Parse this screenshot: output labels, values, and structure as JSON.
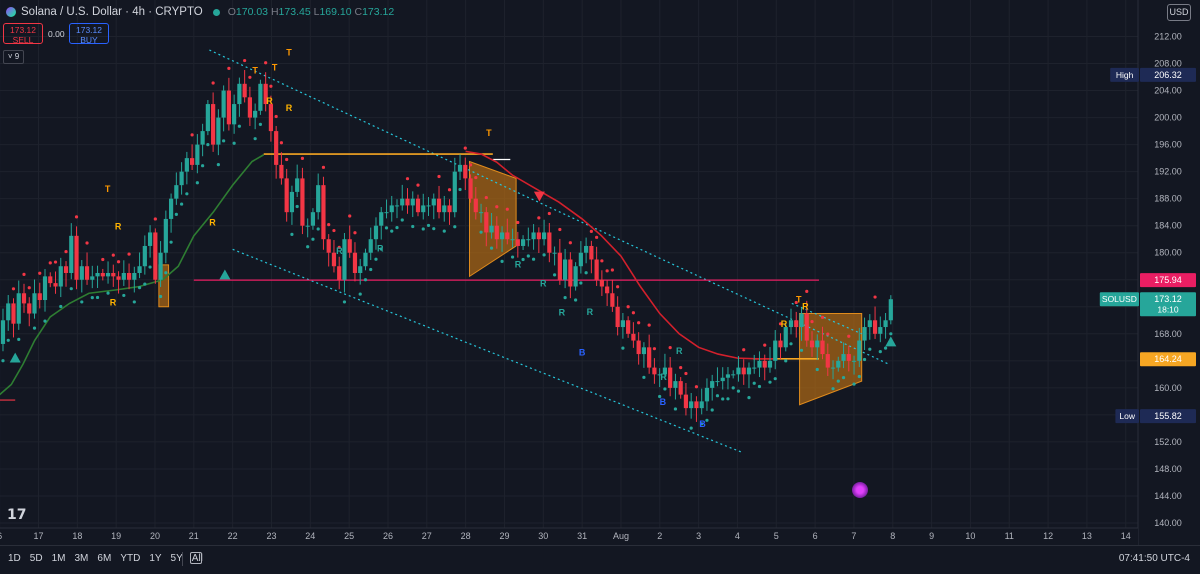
{
  "header": {
    "title": "Solana / U.S. Dollar · 4h · CRYPTO",
    "ohlc": {
      "o_label": "O",
      "o": "170.03",
      "h_label": "H",
      "h": "173.45",
      "l_label": "L",
      "l": "169.10",
      "c_label": "C",
      "c": "173.12"
    }
  },
  "trade": {
    "sell_price": "173.12",
    "sell_label": "SELL",
    "spread": "0.00",
    "buy_price": "173.12",
    "buy_label": "BUY"
  },
  "indicator_count": "9",
  "currency": "USD",
  "bottom": {
    "ranges": [
      "1D",
      "5D",
      "1M",
      "3M",
      "6M",
      "YTD",
      "1Y",
      "5Y",
      "All"
    ],
    "clock": "07:41:50 UTC-4"
  },
  "colors": {
    "bg": "#131722",
    "up": "#26a69a",
    "down": "#f23645",
    "ma_red": "#d3202c",
    "ma_green": "#2e7d32",
    "level_pink": "#e91e63",
    "level_orange": "#f6a623"
  },
  "chart_data": {
    "type": "candlestick",
    "yticks": [
      140,
      144,
      148,
      152,
      156,
      160,
      164,
      168,
      172,
      176,
      180,
      184,
      188,
      192,
      196,
      200,
      204,
      208,
      212
    ],
    "ylim": [
      140,
      214
    ],
    "xticks": [
      {
        "label": "6",
        "t": -1
      },
      {
        "label": "17",
        "t": 0
      },
      {
        "label": "18",
        "t": 1
      },
      {
        "label": "19",
        "t": 2
      },
      {
        "label": "20",
        "t": 3
      },
      {
        "label": "21",
        "t": 4
      },
      {
        "label": "22",
        "t": 5
      },
      {
        "label": "23",
        "t": 6
      },
      {
        "label": "24",
        "t": 7
      },
      {
        "label": "25",
        "t": 8
      },
      {
        "label": "26",
        "t": 9
      },
      {
        "label": "27",
        "t": 10
      },
      {
        "label": "28",
        "t": 11
      },
      {
        "label": "29",
        "t": 12
      },
      {
        "label": "30",
        "t": 13
      },
      {
        "label": "31",
        "t": 14
      },
      {
        "label": "Aug",
        "t": 15
      },
      {
        "label": "2",
        "t": 16
      },
      {
        "label": "3",
        "t": 17
      },
      {
        "label": "4",
        "t": 18
      },
      {
        "label": "5",
        "t": 19
      },
      {
        "label": "6",
        "t": 20
      },
      {
        "label": "7",
        "t": 21
      },
      {
        "label": "8",
        "t": 22
      },
      {
        "label": "9",
        "t": 23
      },
      {
        "label": "10",
        "t": 24
      },
      {
        "label": "11",
        "t": 25
      },
      {
        "label": "12",
        "t": 26
      },
      {
        "label": "13",
        "t": 27
      },
      {
        "label": "14",
        "t": 28
      }
    ],
    "price_labels": [
      {
        "label": "High",
        "value": "206.32",
        "y": 206.32,
        "color": "#1e2a55"
      },
      {
        "label": "",
        "value": "175.94",
        "y": 175.94,
        "color": "#e91e63"
      },
      {
        "label": "SOLUSD",
        "value": "173.12",
        "sub": "18:10",
        "y": 173.12,
        "color": "#26a69a"
      },
      {
        "label": "",
        "value": "164.24",
        "y": 164.24,
        "color": "#f6a623"
      },
      {
        "label": "Low",
        "value": "155.82",
        "y": 155.82,
        "color": "#1e2a55"
      }
    ],
    "closes": [
      166.5,
      170,
      172.5,
      169.5,
      174,
      172.5,
      171,
      174,
      173,
      176.5,
      175.5,
      175,
      178,
      177,
      182.5,
      176,
      178,
      176,
      176.5,
      177,
      176.5,
      177,
      176.5,
      176,
      177,
      176,
      177,
      178,
      181,
      183,
      176,
      180,
      185,
      188,
      190,
      192,
      194,
      193,
      196,
      198,
      202,
      196,
      200,
      204,
      199,
      202,
      205,
      203,
      200,
      201,
      205,
      202,
      198,
      193,
      191,
      186,
      189,
      191,
      184,
      184,
      186,
      190,
      182,
      180,
      178,
      176,
      182,
      180,
      177,
      178,
      180,
      182,
      184,
      186,
      186,
      187,
      187,
      188,
      187,
      188,
      186,
      187,
      187,
      188,
      186,
      187,
      186,
      192,
      193,
      191,
      188,
      186,
      186,
      183,
      184,
      182,
      183,
      182,
      182,
      181,
      182,
      182,
      183,
      182,
      183,
      180,
      180,
      176,
      179,
      175,
      178,
      180,
      181,
      179,
      176,
      175,
      174,
      172,
      169,
      170,
      168,
      167,
      165,
      166,
      163,
      162,
      162,
      163,
      160,
      161,
      159,
      157,
      158,
      157,
      158,
      160,
      161,
      161,
      161.5,
      162,
      162,
      163,
      162,
      163,
      163,
      164,
      163,
      164,
      167,
      166,
      169,
      170,
      169,
      171,
      167,
      166,
      167,
      165,
      163,
      163,
      164,
      165,
      164,
      164,
      167,
      169,
      170,
      168,
      169,
      170,
      173.12
    ],
    "ma_red": [
      [
        11,
        195
      ],
      [
        11.4,
        194.6
      ],
      [
        11.8,
        193.4
      ],
      [
        12.2,
        191.5
      ],
      [
        12.8,
        189.5
      ],
      [
        13.4,
        187.5
      ],
      [
        14,
        185
      ],
      [
        14.5,
        182.5
      ],
      [
        15,
        179.5
      ],
      [
        15.5,
        175
      ],
      [
        16,
        171
      ],
      [
        16.5,
        168
      ],
      [
        17,
        166
      ],
      [
        17.5,
        165
      ],
      [
        18,
        164.4
      ],
      [
        18.5,
        164.3
      ],
      [
        19,
        164.3
      ]
    ],
    "ma_green": [
      [
        -1,
        159
      ],
      [
        -0.7,
        160.5
      ],
      [
        -0.4,
        163.5
      ],
      [
        -0.1,
        167
      ],
      [
        0.3,
        170.5
      ],
      [
        0.8,
        172.5
      ],
      [
        1.3,
        174
      ],
      [
        2,
        174.5
      ],
      [
        2.6,
        175
      ],
      [
        3.2,
        176
      ],
      [
        3.6,
        178
      ],
      [
        4,
        182.5
      ],
      [
        4.5,
        186
      ],
      [
        5,
        190
      ],
      [
        5.5,
        193.5
      ],
      [
        5.8,
        194.5
      ]
    ],
    "levels": [
      {
        "y": 175.94,
        "x0": 4.0,
        "x1": 20.1,
        "color": "#e91e63",
        "width": 1.3
      },
      {
        "y": 194.6,
        "x0": 5.8,
        "x1": 11.7,
        "color": "#f6a623",
        "width": 1.6
      },
      {
        "y": 193.8,
        "x0": 11.7,
        "x1": 12.15,
        "color": "#ffffff",
        "width": 1.2
      },
      {
        "y": 164.3,
        "x0": 18.4,
        "x1": 20.1,
        "color": "#f6a623",
        "width": 1.6
      },
      {
        "y": 158.2,
        "x0": -1.1,
        "x1": -0.6,
        "color": "#f23645",
        "width": 1.1
      }
    ],
    "trendlines": [
      {
        "x0": 4.4,
        "y0": 210,
        "x1": 21.9,
        "y1": 163.5
      },
      {
        "x0": 5.0,
        "y0": 180.5,
        "x1": 18.1,
        "y1": 150.5
      },
      {
        "x0": 19.4,
        "y0": 172.5,
        "x1": 21.2,
        "y1": 168
      }
    ],
    "zones": [
      {
        "points": [
          [
            3.1,
            178.2
          ],
          [
            3.35,
            178.2
          ],
          [
            3.35,
            172
          ],
          [
            3.1,
            172
          ]
        ]
      },
      {
        "points": [
          [
            11.1,
            193.5
          ],
          [
            12.3,
            191
          ],
          [
            12.3,
            181
          ],
          [
            11.1,
            176.5
          ]
        ]
      },
      {
        "points": [
          [
            19.6,
            171
          ],
          [
            21.2,
            171
          ],
          [
            21.2,
            161
          ],
          [
            19.6,
            157.5
          ]
        ]
      }
    ],
    "marks": [
      {
        "t": "R",
        "x": 1.92,
        "y": 172.2,
        "c": "#ffb300"
      },
      {
        "t": "T",
        "x": 1.78,
        "y": 189.0,
        "c": "#ff9800"
      },
      {
        "t": "R",
        "x": 2.05,
        "y": 183.4,
        "c": "#ffb300"
      },
      {
        "t": "R",
        "x": 4.48,
        "y": 184.0,
        "c": "#ffb300"
      },
      {
        "t": "T",
        "x": 5.58,
        "y": 206.5,
        "c": "#ff9800"
      },
      {
        "t": "T",
        "x": 6.08,
        "y": 207.0,
        "c": "#ff9800"
      },
      {
        "t": "T",
        "x": 6.45,
        "y": 209.2,
        "c": "#ff9800"
      },
      {
        "t": "R",
        "x": 5.95,
        "y": 202.0,
        "c": "#ffb300"
      },
      {
        "t": "R",
        "x": 6.45,
        "y": 201.0,
        "c": "#ffb300"
      },
      {
        "t": "R",
        "x": 7.75,
        "y": 179.8,
        "c": "#26a69a"
      },
      {
        "t": "R",
        "x": 8.8,
        "y": 180.2,
        "c": "#26a69a"
      },
      {
        "t": "T",
        "x": 11.6,
        "y": 197.3,
        "c": "#ff9800"
      },
      {
        "t": "R",
        "x": 12.35,
        "y": 177.8,
        "c": "#26a69a"
      },
      {
        "t": "R",
        "x": 13.0,
        "y": 175.0,
        "c": "#26a69a"
      },
      {
        "t": "R",
        "x": 13.48,
        "y": 170.7,
        "c": "#26a69a"
      },
      {
        "t": "B",
        "x": 14.0,
        "y": 164.8,
        "c": "#2962ff"
      },
      {
        "t": "R",
        "x": 14.2,
        "y": 170.8,
        "c": "#26a69a"
      },
      {
        "t": "R",
        "x": 16.1,
        "y": 161.2,
        "c": "#26a69a"
      },
      {
        "t": "R",
        "x": 16.5,
        "y": 165.0,
        "c": "#26a69a"
      },
      {
        "t": "B",
        "x": 16.08,
        "y": 157.5,
        "c": "#2962ff"
      },
      {
        "t": "B",
        "x": 17.1,
        "y": 154.2,
        "c": "#2962ff"
      },
      {
        "t": "R",
        "x": 19.2,
        "y": 169.0,
        "c": "#ffb300"
      },
      {
        "t": "T",
        "x": 19.58,
        "y": 172.6,
        "c": "#ff9800"
      },
      {
        "t": "R",
        "x": 19.75,
        "y": 171.6,
        "c": "#ffb300"
      }
    ],
    "triangles": [
      {
        "x": -0.6,
        "y": 164.4,
        "dir": "up",
        "c": "#26a69a"
      },
      {
        "x": 4.8,
        "y": 176.7,
        "dir": "up",
        "c": "#26a69a"
      },
      {
        "x": 12.9,
        "y": 188.4,
        "dir": "down",
        "c": "#f23645"
      },
      {
        "x": 21.95,
        "y": 166.8,
        "dir": "up",
        "c": "#26a69a"
      }
    ]
  }
}
